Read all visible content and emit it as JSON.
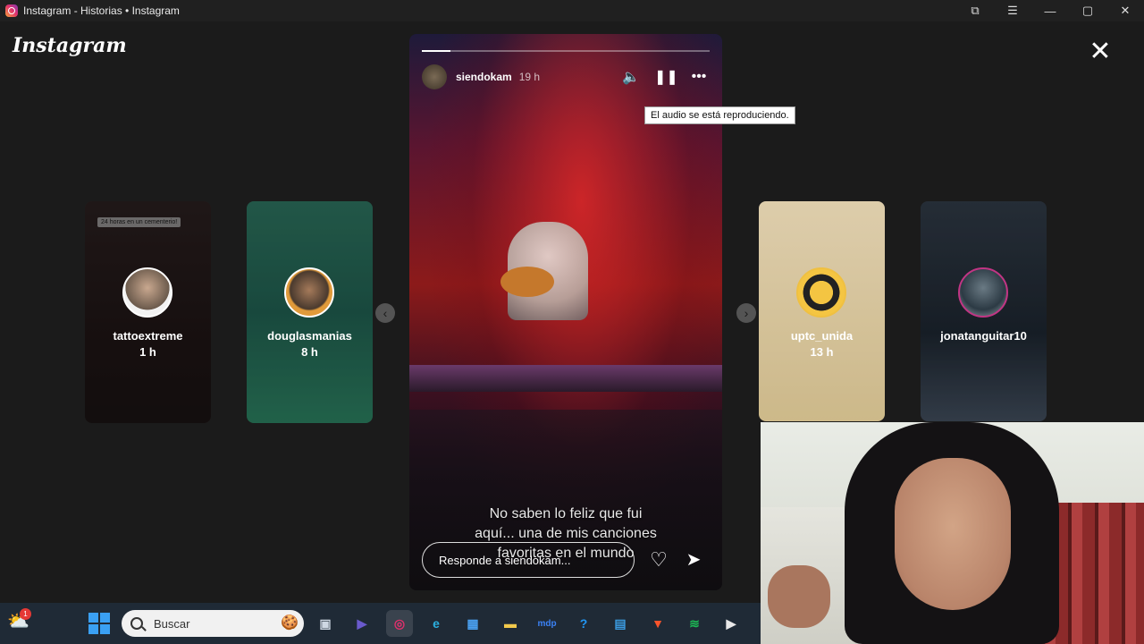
{
  "window": {
    "title": "Instagram - Historias • Instagram",
    "controls": {
      "extensions": "⧉",
      "menu": "☰",
      "minimize": "—",
      "maximize": "▢",
      "close": "✕"
    }
  },
  "viewer": {
    "logo": "Instagram",
    "close_label": "✕",
    "prev_arrow": "‹",
    "next_arrow": "›"
  },
  "previews": [
    {
      "username": "tattoextreme",
      "time": "1 h",
      "overlay_tag": "24 horas en un cementerio!"
    },
    {
      "username": "douglasmanias",
      "time": "8 h"
    },
    {
      "username": "uptc_unida",
      "time": "13 h"
    },
    {
      "username": "jonatanguitar10",
      "time": ""
    }
  ],
  "story": {
    "username": "siendokam",
    "age": "19 h",
    "progress": 0.1,
    "mute_icon": "🔈",
    "pause_icon": "❚❚",
    "more_icon": "•••",
    "tooltip": "El audio se está reproduciendo.",
    "caption": [
      "No saben lo feliz que fui",
      "aquí... una de mis canciones",
      "favoritas en el mundo"
    ],
    "reply_placeholder": "Responde a siendokam...",
    "like_icon": "♡",
    "send_icon": "➤"
  },
  "taskbar": {
    "notification_count": "1",
    "search_label": "Buscar",
    "apps": [
      {
        "name": "task-view",
        "glyph": "▣",
        "color": "#cfd8e3"
      },
      {
        "name": "meet",
        "glyph": "▶",
        "color": "#6a5acd"
      },
      {
        "name": "instagram",
        "glyph": "◎",
        "color": "#e1306c"
      },
      {
        "name": "edge",
        "glyph": "e",
        "color": "#2bb0e0"
      },
      {
        "name": "store",
        "glyph": "▦",
        "color": "#4aa0f0"
      },
      {
        "name": "explorer",
        "glyph": "▬",
        "color": "#f2c94c"
      },
      {
        "name": "mdp",
        "glyph": "mdp",
        "color": "#3b82f6"
      },
      {
        "name": "help",
        "glyph": "?",
        "color": "#2196f3"
      },
      {
        "name": "notes",
        "glyph": "▤",
        "color": "#3b9be0"
      },
      {
        "name": "brave",
        "glyph": "▼",
        "color": "#fb542b"
      },
      {
        "name": "spotify",
        "glyph": "≋",
        "color": "#1db954"
      },
      {
        "name": "player",
        "glyph": "▶",
        "color": "#e8e8e8"
      }
    ]
  }
}
